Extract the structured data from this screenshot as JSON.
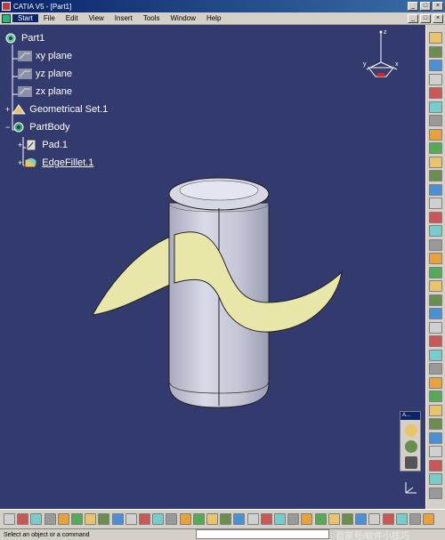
{
  "window": {
    "title": "CATIA V5 - [Part1]"
  },
  "menu": {
    "items": [
      "Start",
      "File",
      "Edit",
      "View",
      "Insert",
      "Tools",
      "Window",
      "Help"
    ]
  },
  "tree": {
    "root": "Part1",
    "planes": [
      "xy plane",
      "yz plane",
      "zx plane"
    ],
    "geometrical_set": "Geometrical Set.1",
    "part_body": "PartBody",
    "pad": "Pad.1",
    "edge_fillet": "EdgeFillet.1"
  },
  "compass": {
    "z": "z",
    "x": "x",
    "y": "y"
  },
  "mini_toolbar": {
    "title": "A..."
  },
  "status": {
    "message": "Select an object or a command"
  },
  "watermark": {
    "text": "百家号/软件小技巧"
  },
  "colors": {
    "viewport_bg": "#333a6e",
    "cylinder": "#c8cad8",
    "surface": "#e8e6a8",
    "tree_text": "#ffffff"
  }
}
